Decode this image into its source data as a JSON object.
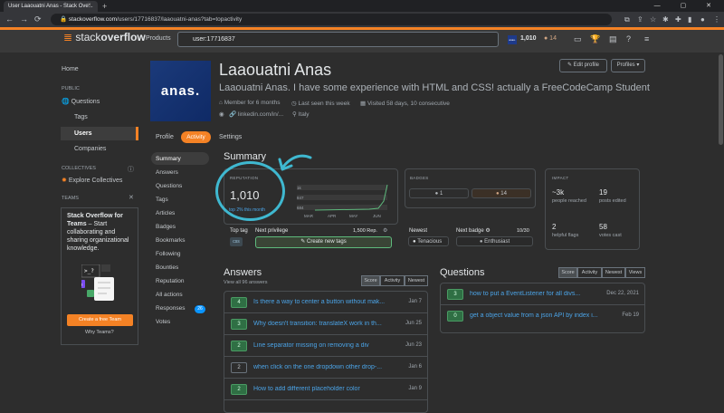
{
  "browser": {
    "tab_title": "User Laaouatni Anas - Stack Ove...",
    "tab_close": "×",
    "new_tab": "+",
    "window_controls": "— ▢ ✕",
    "url_host": "stackoverflow.com",
    "url_path": "/users/17716837/laaouatni-anas?tab=topactivity"
  },
  "topbar": {
    "logo_stack": "stack",
    "logo_overflow": "overflow",
    "products": "Products",
    "search_value": "user:17716837",
    "reputation": "1,010",
    "badge_bronze": "● 14",
    "accent": "#f48225"
  },
  "leftnav": {
    "home": "Home",
    "public": "PUBLIC",
    "questions": "Questions",
    "tags": "Tags",
    "users": "Users",
    "companies": "Companies",
    "collectives": "COLLECTIVES",
    "explore_collectives": "Explore Collectives",
    "teams": "TEAMS",
    "teams_title": "Stack Overflow for Teams",
    "teams_desc": " – Start collaborating and sharing organizational knowledge.",
    "create_team": "Create a free Team",
    "why_teams": "Why Teams?"
  },
  "profile": {
    "avatar_text": "anas.",
    "name": "Laaouatni Anas",
    "title": "Laaouatni Anas. I have some experience with HTML and CSS! actually a FreeCodeCamp Student",
    "member_for": "Member for 6 months",
    "last_seen": "Last seen this week",
    "visited": "Visited 58 days, 10 consecutive",
    "linkedin": "linkedin.com/in/...",
    "location": "Italy",
    "edit_profile": "Edit profile",
    "profiles": "Profiles ▾",
    "tabs": [
      "Profile",
      "Activity",
      "Settings"
    ]
  },
  "activity_nav": [
    "Summary",
    "Answers",
    "Questions",
    "Tags",
    "Articles",
    "Badges",
    "Bookmarks",
    "Following",
    "Bounties",
    "Reputation",
    "All actions",
    "Responses",
    "Votes"
  ],
  "responses_count": "26",
  "summary": {
    "title": "Summary",
    "reputation_label": "REPUTATION",
    "reputation": "1,010",
    "top_percent": "top 2% this month",
    "graph_ylabels": [
      "1k",
      "847",
      "684"
    ],
    "graph_xlabels": [
      "MAR",
      "APR",
      "MAY",
      "JUN"
    ],
    "top_tag_label": "Top tag",
    "top_tag": "css",
    "next_privilege": "Next privilege",
    "next_privilege_rep": "1,500 Rep.",
    "create_new_tags": "Create new tags",
    "badges_label": "BADGES",
    "silver_count": "1",
    "bronze_count": "14",
    "newest_label": "Newest",
    "newest_badge": "Tenacious",
    "next_badge_label": "Next badge",
    "next_badge_progress": "10/30",
    "next_badge": "Enthusiast",
    "impact_label": "IMPACT",
    "people_reached_val": "~3k",
    "people_reached": "people reached",
    "posts_edited_val": "19",
    "posts_edited": "posts edited",
    "helpful_flags_val": "2",
    "helpful_flags": "helpful flags",
    "votes_cast_val": "58",
    "votes_cast": "votes cast"
  },
  "answers": {
    "title": "Answers",
    "view_all": "View all 96 answers",
    "sort": [
      "Score",
      "Activity",
      "Newest"
    ],
    "items": [
      {
        "score": "4",
        "accepted": true,
        "title": "Is there a way to center a button without mak...",
        "date": "Jan 7"
      },
      {
        "score": "3",
        "accepted": true,
        "title": "Why doesn't transition: translateX work in th...",
        "date": "Jun 25"
      },
      {
        "score": "2",
        "accepted": true,
        "title": "Line separator missing on removing a div",
        "date": "Jun 23"
      },
      {
        "score": "2",
        "accepted": false,
        "title": "when click on the one dropdown other drop-...",
        "date": "Jan 6"
      },
      {
        "score": "2",
        "accepted": true,
        "title": "How to add different placeholder color",
        "date": "Jan 9"
      }
    ]
  },
  "questions": {
    "title": "Questions",
    "sort": [
      "Score",
      "Activity",
      "Newest",
      "Views"
    ],
    "items": [
      {
        "score": "3",
        "accepted": true,
        "title": "how to put a EventListener for all divs...",
        "date": "Dec 22, 2021"
      },
      {
        "score": "0",
        "accepted": true,
        "title": "get a object value from a json API by index i...",
        "date": "Feb 19"
      }
    ]
  }
}
